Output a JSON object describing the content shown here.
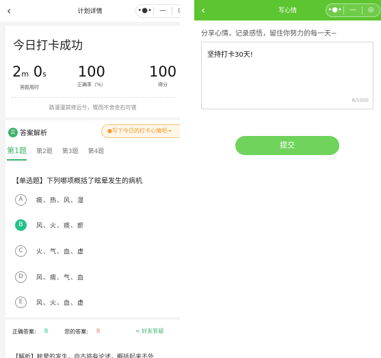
{
  "left_nav": {
    "back": "‹",
    "title": "计划详情",
    "capsule": {
      "more": "•●•",
      "minimize": "—",
      "close": "◎"
    }
  },
  "summary": {
    "heading": "今日打卡成功",
    "time": {
      "minutes": "2",
      "m_unit": "m",
      "seconds": "0",
      "s_unit": "s",
      "label": "答题用时"
    },
    "accuracy": {
      "value": "100",
      "label": "正确率（%）"
    },
    "score": {
      "value": "100",
      "label": "得分"
    },
    "quote": "路漫漫其修远兮，锲而不舍金石可镂"
  },
  "analysis": {
    "icon_glyph": "☰",
    "title": "答案解析",
    "write_hint": "●写下今日的打卡心情吧→",
    "tabs": [
      "第1题",
      "第2题",
      "第3题",
      "第4题"
    ],
    "question": "【单选题】下列哪项概括了眩晕发生的病机",
    "options": [
      {
        "letter": "A",
        "text": "痰、热、风、湿"
      },
      {
        "letter": "B",
        "text": "风、火、痰、瘀"
      },
      {
        "letter": "C",
        "text": "火、气、血、虚"
      },
      {
        "letter": "D",
        "text": "风、痰、气、血"
      },
      {
        "letter": "E",
        "text": "风、火、血、虚"
      }
    ],
    "correct_label": "正确答案:",
    "correct_value": "B",
    "your_label": "您的答案:",
    "your_value": "B",
    "share_label": "好友答疑",
    "analysis_text": "【解析】眩晕的发生，自古将有论述，概括起来不外"
  },
  "right_nav": {
    "back": "‹",
    "title": "写心情",
    "capsule": {
      "more": "•●•",
      "minimize": "—",
      "close": "◎"
    }
  },
  "mood": {
    "prompt": "分享心情，记录感悟，留住你努力的每一天~",
    "text": "坚持打卡30天!",
    "counter": "8/1000",
    "submit": "提交"
  },
  "colors": {
    "accent_green": "#5cc530",
    "selected_option": "#26c28a",
    "submit_button": "#6fd35c",
    "hint_orange": "#f09a2a"
  }
}
